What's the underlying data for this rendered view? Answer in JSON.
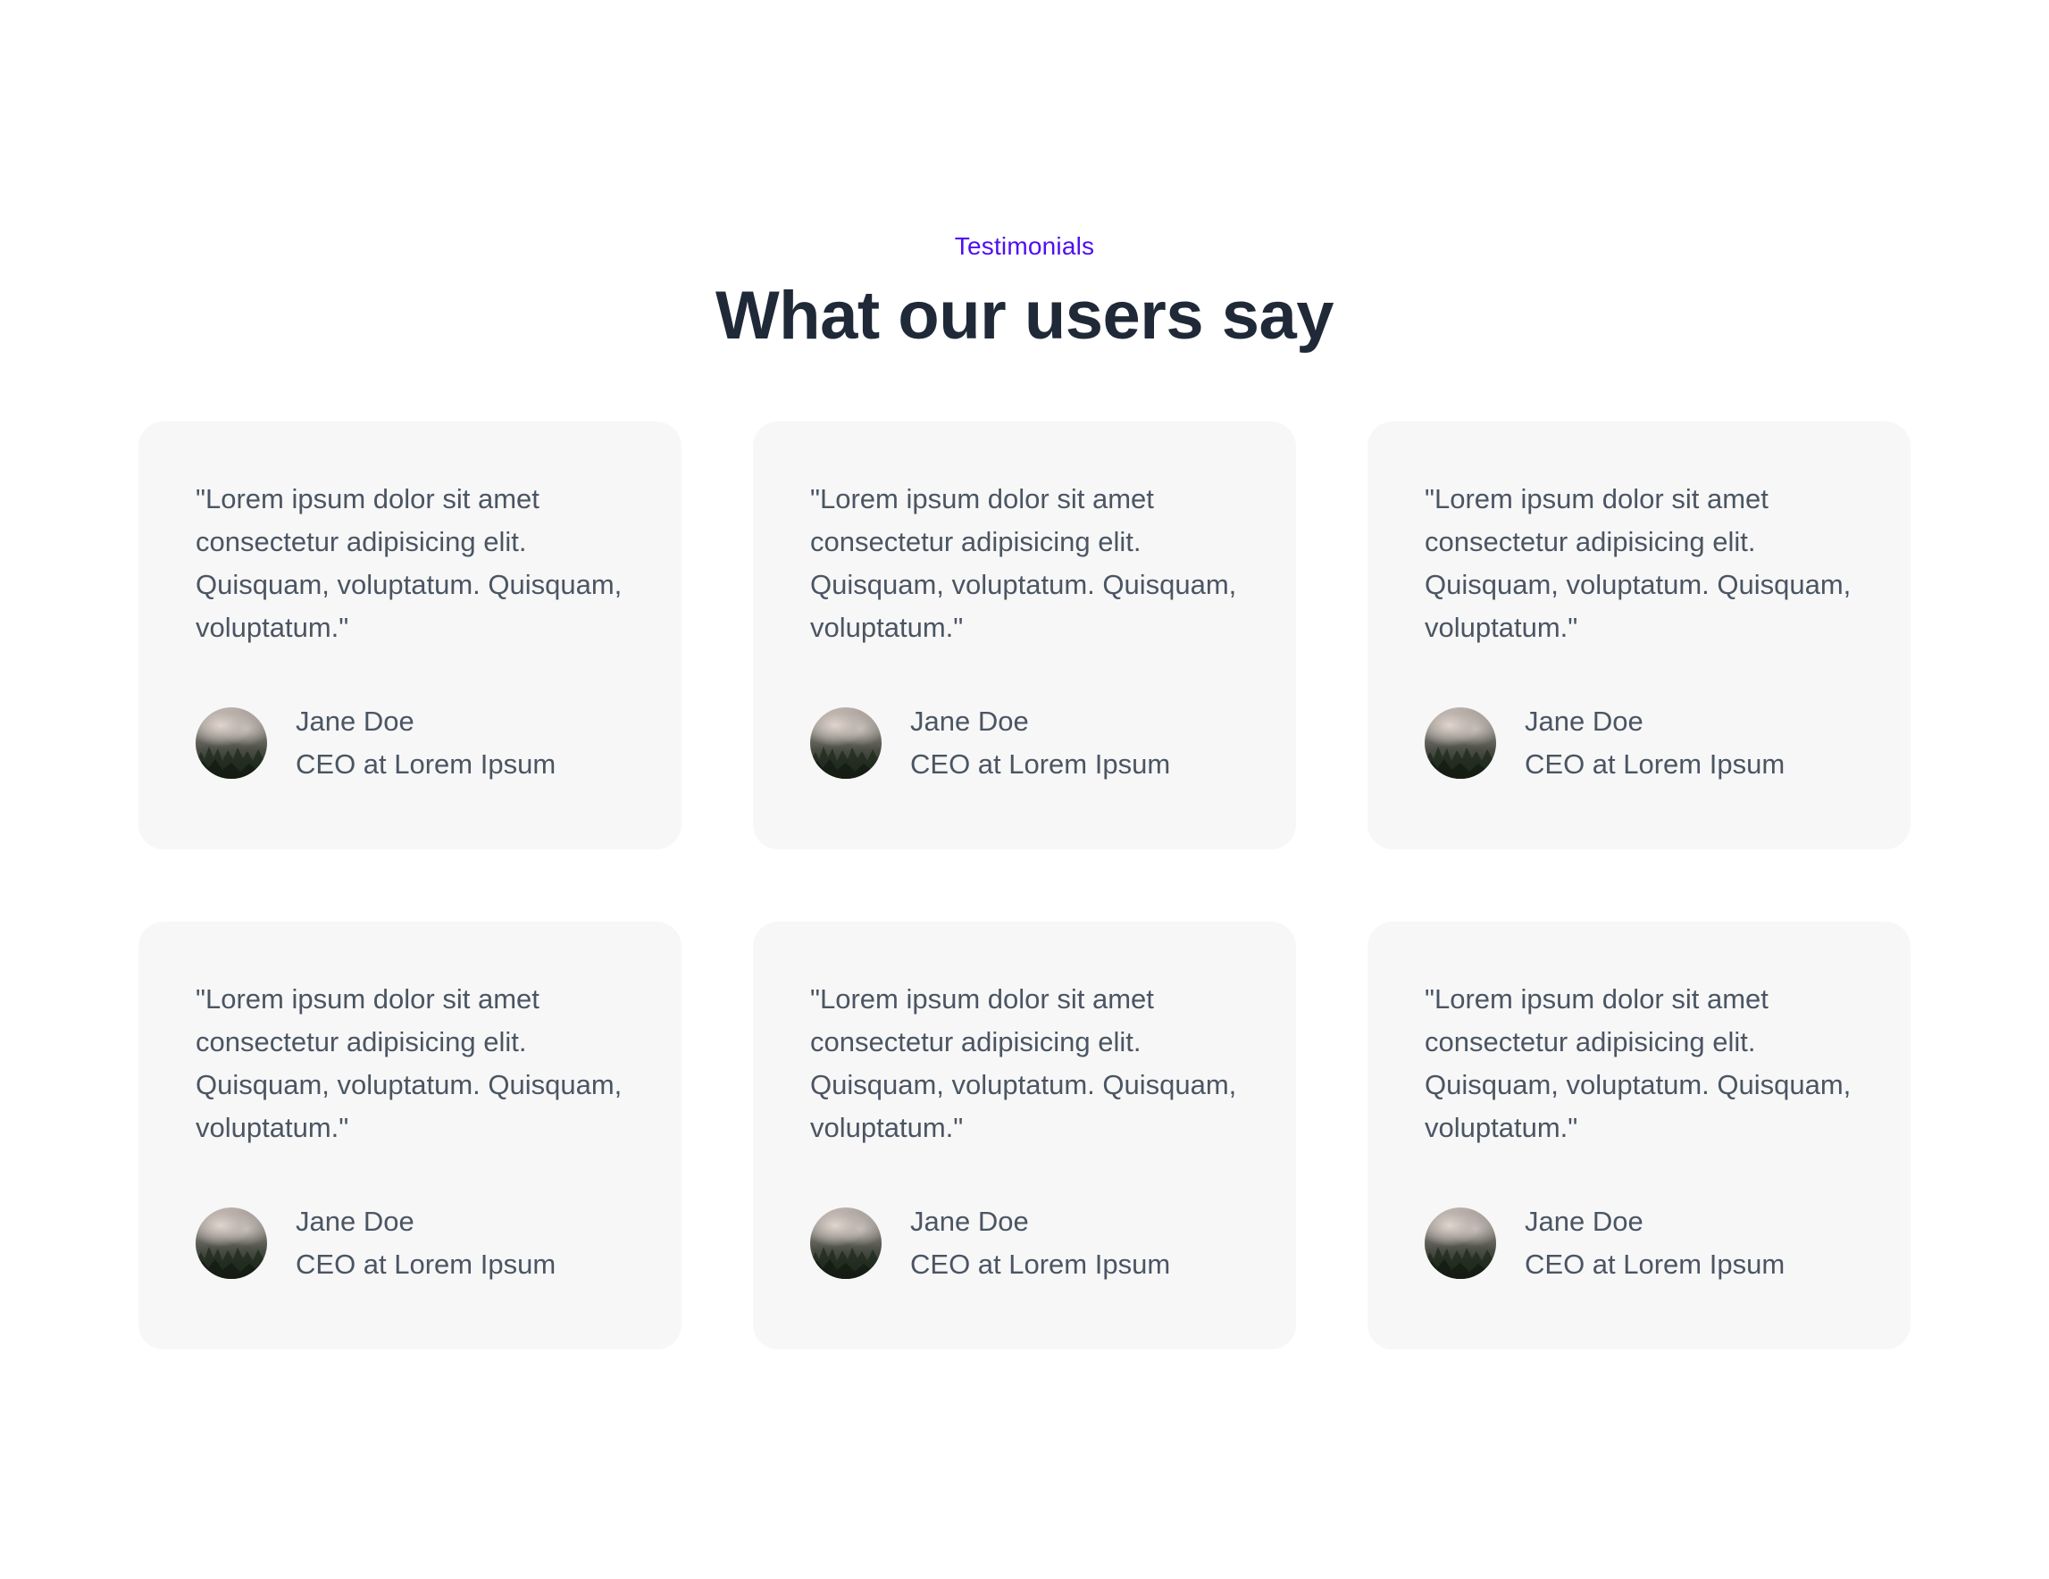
{
  "section": {
    "eyebrow": "Testimonials",
    "title": "What our users say"
  },
  "testimonials": [
    {
      "quote": "\"Lorem ipsum dolor sit amet consectetur adipisicing elit. Quisquam, voluptatum. Quisquam, voluptatum.\"",
      "name": "Jane Doe",
      "role": "CEO at Lorem Ipsum",
      "avatar_icon": "avatar-forest-photo"
    },
    {
      "quote": "\"Lorem ipsum dolor sit amet consectetur adipisicing elit. Quisquam, voluptatum. Quisquam, voluptatum.\"",
      "name": "Jane Doe",
      "role": "CEO at Lorem Ipsum",
      "avatar_icon": "avatar-forest-photo"
    },
    {
      "quote": "\"Lorem ipsum dolor sit amet consectetur adipisicing elit. Quisquam, voluptatum. Quisquam, voluptatum.\"",
      "name": "Jane Doe",
      "role": "CEO at Lorem Ipsum",
      "avatar_icon": "avatar-forest-photo"
    },
    {
      "quote": "\"Lorem ipsum dolor sit amet consectetur adipisicing elit. Quisquam, voluptatum. Quisquam, voluptatum.\"",
      "name": "Jane Doe",
      "role": "CEO at Lorem Ipsum",
      "avatar_icon": "avatar-forest-photo"
    },
    {
      "quote": "\"Lorem ipsum dolor sit amet consectetur adipisicing elit. Quisquam, voluptatum. Quisquam, voluptatum.\"",
      "name": "Jane Doe",
      "role": "CEO at Lorem Ipsum",
      "avatar_icon": "avatar-forest-photo"
    },
    {
      "quote": "\"Lorem ipsum dolor sit amet consectetur adipisicing elit. Quisquam, voluptatum. Quisquam, voluptatum.\"",
      "name": "Jane Doe",
      "role": "CEO at Lorem Ipsum",
      "avatar_icon": "avatar-forest-photo"
    }
  ],
  "colors": {
    "accent": "#4f0ff0",
    "heading": "#1f2937",
    "body_text": "#4b5563",
    "card_background": "#f7f7f7",
    "page_background": "#ffffff"
  }
}
